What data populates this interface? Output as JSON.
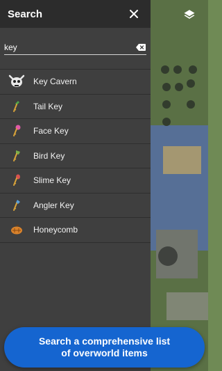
{
  "drawer": {
    "title": "Search",
    "close_icon": "close-icon"
  },
  "search": {
    "value": "key",
    "clear_icon": "backspace-clear-icon"
  },
  "map": {
    "layers_icon": "layers-icon"
  },
  "results": [
    {
      "label": "Key Cavern",
      "icon": "key-cavern-skull-icon",
      "color": "#e8e8e8"
    },
    {
      "label": "Tail Key",
      "icon": "tail-key-icon",
      "color": "#4fa84a"
    },
    {
      "label": "Face Key",
      "icon": "face-key-icon",
      "color": "#e25aa8"
    },
    {
      "label": "Bird Key",
      "icon": "bird-key-icon",
      "color": "#7db04a"
    },
    {
      "label": "Slime Key",
      "icon": "slime-key-icon",
      "color": "#d9534f"
    },
    {
      "label": "Angler Key",
      "icon": "angler-key-icon",
      "color": "#5aa0d9"
    },
    {
      "label": "Honeycomb",
      "icon": "honeycomb-icon",
      "color": "#d9822b"
    }
  ],
  "promo": {
    "text": "Search a comprehensive list of overworld items"
  },
  "colors": {
    "drawer_bg": "#3f3f3f",
    "header_bg": "#2c2c2c",
    "promo_bg": "#1565d0"
  }
}
